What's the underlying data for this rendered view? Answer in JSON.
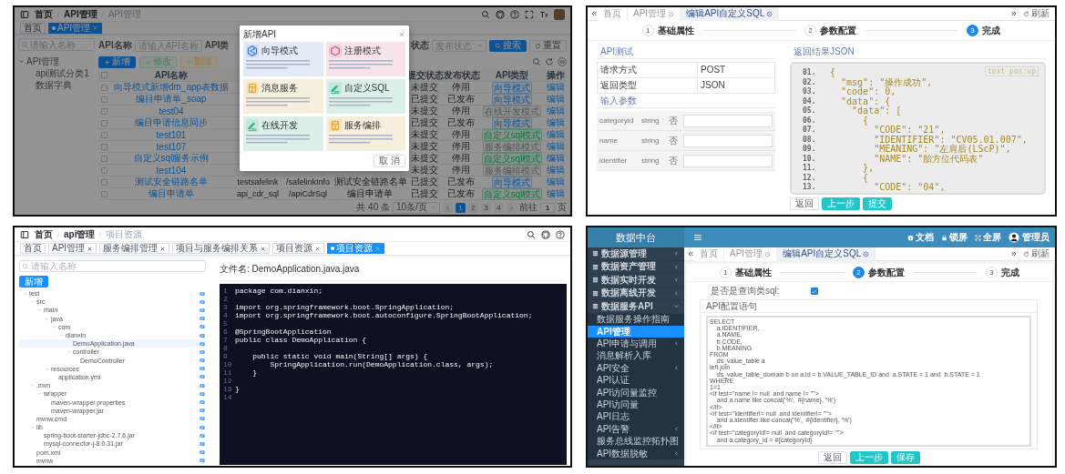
{
  "api_list_screen": {
    "breadcrumb": [
      "首页",
      "API管理",
      "API管理"
    ],
    "tags": [
      {
        "label": "首页",
        "selected": false,
        "closable": false
      },
      {
        "label": "API管理",
        "selected": true,
        "closable": true
      }
    ],
    "tree_search": {
      "placeholder": "请输入名称"
    },
    "tree": [
      {
        "label": "API管理",
        "expanded": true,
        "children": [
          {
            "label": "api测试分类1"
          },
          {
            "label": "数据字典"
          }
        ]
      }
    ],
    "filters": [
      {
        "label": "API名称",
        "kind": "input",
        "placeholder": "请输入API名称"
      },
      {
        "label": "API类",
        "kind": "label"
      },
      {
        "label": "状态",
        "kind": "select",
        "placeholder": "发布状态"
      }
    ],
    "filter_buttons": [
      {
        "label": "搜索",
        "kind": "primary"
      },
      {
        "label": "重置",
        "kind": "default"
      }
    ],
    "actions": [
      {
        "label": "新增",
        "kind": "add",
        "disabled": false
      },
      {
        "label": "修改",
        "kind": "edit",
        "disabled": true
      },
      {
        "label": "删除",
        "kind": "delete",
        "disabled": true
      }
    ],
    "columns": [
      "API名称",
      "提交状态",
      "发布状态",
      "API类型",
      "操作"
    ],
    "header_checked": false,
    "rows": [
      {
        "name": "向导模式新增dm_app表数据",
        "submit_status": "未提交",
        "publish_status": "停用",
        "api_type": {
          "label": "向导模式",
          "kind": "wizard"
        },
        "action": "编辑",
        "checked": false
      },
      {
        "name": "编目申请单_soap",
        "submit_status": "已提交",
        "publish_status": "已发布",
        "api_type": {
          "label": "向导模式",
          "kind": "wizard"
        },
        "action": "编辑",
        "checked": false
      },
      {
        "name": "test04",
        "submit_status": "未提交",
        "publish_status": "停用",
        "api_type": {
          "label": "在线开发模式",
          "kind": "plain"
        },
        "action": "编辑",
        "checked": false
      },
      {
        "name": "编目申请信息同步",
        "submit_status": "已提交",
        "publish_status": "已发布",
        "api_type": {
          "label": "向导模式",
          "kind": "wizard"
        },
        "action": "编辑",
        "checked": false
      },
      {
        "name": "test101",
        "submit_status": "未提交",
        "publish_status": "停用",
        "api_type": {
          "label": "自定义sql模式",
          "kind": "sql"
        },
        "action": "编辑",
        "checked": false
      },
      {
        "name": "test107",
        "submit_status": "未提交",
        "publish_status": "停用",
        "api_type": {
          "label": "服务编排模式",
          "kind": "plain"
        },
        "action": "编辑",
        "checked": false
      },
      {
        "name": "自定义sql服务示例",
        "submit_status": "未提交",
        "publish_status": "停用",
        "api_type": {
          "label": "自定义sql模式",
          "kind": "sql"
        },
        "action": "编辑",
        "checked": false
      },
      {
        "name": "test104",
        "submit_status": "未提交",
        "publish_status": "停用",
        "api_type": {
          "label": "服务编排模式",
          "kind": "plain"
        },
        "action": "编辑",
        "checked": false
      },
      {
        "name": "测试安全链路名单",
        "column_3": "testsafelink",
        "column_4": "/safelinkInfo",
        "column_5": "测试安全链路名单",
        "submit_status": "已提交",
        "publish_status": "已发布",
        "api_type": {
          "label": "向导模式",
          "kind": "wizard"
        },
        "action": "编辑",
        "checked": false
      },
      {
        "name": "编目申请单",
        "column_3": "api_cdr_sql",
        "column_4": "/apiCdrSql",
        "column_5": "编目申请单",
        "submit_status": "已提交",
        "publish_status": "已发布",
        "api_type": {
          "label": "自定义sql模式",
          "kind": "sql"
        },
        "action": "编辑",
        "checked": false
      }
    ],
    "pagination": {
      "total": "共 40 条",
      "page_size": "10条/页",
      "pages": [
        {
          "label": "1",
          "selected": true
        },
        {
          "label": "2",
          "selected": false
        },
        {
          "label": "3",
          "selected": false
        },
        {
          "label": "4",
          "selected": false
        }
      ],
      "goto_label": "前往",
      "goto_value": "1",
      "goto_suffix": "页"
    },
    "modal": {
      "title": "新增API",
      "cards": [
        {
          "title": "向导模式",
          "color": "#e3ebf6"
        },
        {
          "title": "注册模式",
          "color": "#f6e4ea"
        },
        {
          "title": "消息服务",
          "color": "#f6efde"
        },
        {
          "title": "自定义SQL",
          "color": "#dcefe9"
        },
        {
          "title": "在线开发",
          "color": "#dcefe9"
        },
        {
          "title": "服务编排",
          "color": "#f6efde"
        }
      ],
      "cancel": "取 消"
    }
  },
  "api_test_screen": {
    "tabs": [
      {
        "label": "首页",
        "selected": false,
        "closable": false
      },
      {
        "label": "API管理",
        "selected": false,
        "closable": true
      },
      {
        "label": "编辑API自定义SQL",
        "selected": true,
        "closable": true
      }
    ],
    "refresh": "刷新",
    "steps": [
      {
        "number": "1",
        "label": "基础属性",
        "selected": false
      },
      {
        "number": "2",
        "label": "参数配置",
        "selected": false
      },
      {
        "number": "3",
        "label": "完成",
        "selected": true
      }
    ],
    "test_title": "API测试",
    "info": [
      {
        "label": "请求方式",
        "value": "POST"
      },
      {
        "label": "返回类型",
        "value": "JSON"
      }
    ],
    "params_title": "输入参数",
    "params": [
      {
        "name": "categoryId",
        "type": "string",
        "required": "否"
      },
      {
        "name": "name",
        "type": "string",
        "required": "否"
      },
      {
        "name": "identifier",
        "type": "string",
        "required": "否"
      }
    ],
    "result_title": "返回结果JSON",
    "badge": "text pos:up",
    "lines": [
      {
        "number": "01.",
        "code": "{"
      },
      {
        "number": "02.",
        "code": "  \"msg\": \"操作成功\","
      },
      {
        "number": "03.",
        "code": "  \"code\": 0,"
      },
      {
        "number": "04.",
        "code": "  \"data\": {"
      },
      {
        "number": "05.",
        "code": "    \"data\": ["
      },
      {
        "number": "06.",
        "code": "      {"
      },
      {
        "number": "07.",
        "code": "        \"CODE\": \"21\","
      },
      {
        "number": "08.",
        "code": "        \"IDENTIFIER\": \"CV05.01.007\","
      },
      {
        "number": "09.",
        "code": "        \"MEANING\": \"左肩后(LScP)\","
      },
      {
        "number": "10.",
        "code": "        \"NAME\": \"胎方位代码表\""
      },
      {
        "number": "11.",
        "code": "      },"
      },
      {
        "number": "12.",
        "code": "      {"
      },
      {
        "number": "13.",
        "code": "        \"CODE\": \"04\","
      }
    ],
    "buttons": [
      {
        "label": "返回",
        "kind": "default"
      },
      {
        "label": "上一步",
        "kind": "primary"
      },
      {
        "label": "提交",
        "kind": "primary"
      }
    ]
  },
  "code_browser_screen": {
    "breadcrumb": [
      "首页",
      "api管理",
      "项目资源"
    ],
    "tags": [
      {
        "label": "首页",
        "selected": false,
        "closable": false
      },
      {
        "label": "API管理",
        "selected": false,
        "closable": true
      },
      {
        "label": "服务编排管理",
        "selected": false,
        "closable": true
      },
      {
        "label": "项目与服务编排关系",
        "selected": false,
        "closable": true
      },
      {
        "label": "项目资源",
        "selected": false,
        "closable": true
      },
      {
        "label": "项目资源",
        "selected": true,
        "closable": true
      }
    ],
    "search": {
      "placeholder": "请输入名称"
    },
    "add_button": "新增",
    "tree": [
      {
        "label": "test",
        "expanded": true,
        "selected": false,
        "children": [
          {
            "label": "src",
            "expanded": true,
            "selected": false,
            "children": [
              {
                "label": "main",
                "expanded": true,
                "selected": false,
                "children": [
                  {
                    "label": "java",
                    "expanded": true,
                    "selected": false,
                    "children": [
                      {
                        "label": "com",
                        "expanded": true,
                        "selected": false,
                        "children": [
                          {
                            "label": "dianxin",
                            "expanded": true,
                            "selected": false,
                            "children": [
                              {
                                "label": "DemoApplication.java",
                                "selected": true
                              },
                              {
                                "label": "controller",
                                "expanded": true,
                                "selected": false,
                                "children": [
                                  {
                                    "label": "DemoController",
                                    "selected": false
                                  }
                                ]
                              }
                            ]
                          }
                        ]
                      }
                    ]
                  },
                  {
                    "label": "resources",
                    "expanded": true,
                    "selected": false,
                    "children": [
                      {
                        "label": "application.yml",
                        "selected": false
                      }
                    ]
                  }
                ]
              }
            ]
          },
          {
            "label": ".mvn",
            "expanded": true,
            "selected": false,
            "children": [
              {
                "label": "wrapper",
                "expanded": true,
                "selected": false,
                "children": [
                  {
                    "label": "maven-wrapper.properties",
                    "selected": false
                  },
                  {
                    "label": "maven-wrapper.jar",
                    "selected": false
                  }
                ]
              }
            ]
          },
          {
            "label": "mvnw.cmd",
            "selected": false
          },
          {
            "label": "lib",
            "expanded": true,
            "selected": false,
            "children": [
              {
                "label": "spring-boot-starter-jdbc-2.7.6.jar",
                "selected": false
              },
              {
                "label": "mysql-connector-j-8.0.31.jar",
                "selected": false
              }
            ]
          },
          {
            "label": "pom.xml",
            "selected": false
          },
          {
            "label": "mvnw",
            "selected": false
          }
        ]
      }
    ],
    "file_title": "文件名: DemoApplication.java.java",
    "lines": [
      {
        "number": "1",
        "code": "package com.dianxin;"
      },
      {
        "number": "2"
      },
      {
        "number": "3",
        "code": "import org.springframework.boot.SpringApplication;"
      },
      {
        "number": "4",
        "code": "import org.springframework.boot.autoconfigure.SpringBootApplication;"
      },
      {
        "number": "5"
      },
      {
        "number": "6",
        "code": "@SpringBootApplication"
      },
      {
        "number": "7",
        "code": "public class DemoApplication {"
      },
      {
        "number": "8"
      },
      {
        "number": "9",
        "code": "    public static void main(String[] args) {"
      },
      {
        "number": "10",
        "code": "        SpringApplication.run(DemoApplication.class, args);"
      },
      {
        "number": "11",
        "code": "    }"
      },
      {
        "number": "12"
      },
      {
        "number": "13",
        "code": "}"
      },
      {
        "number": "14"
      }
    ]
  },
  "sql_config_screen": {
    "app_title": "数据中台",
    "menus": [
      {
        "label": "数据源管理",
        "expanded": false
      },
      {
        "label": "数据资产管理",
        "expanded": false
      },
      {
        "label": "数据实时开发",
        "expanded": false
      },
      {
        "label": "数据离线开发",
        "expanded": false
      },
      {
        "label": "数据服务API",
        "expanded": true,
        "children": [
          {
            "label": "数据服务操作指南",
            "selected": false,
            "submenu": false
          },
          {
            "label": "API管理",
            "selected": true,
            "submenu": false
          },
          {
            "label": "API申请与调用",
            "selected": false,
            "submenu": true
          },
          {
            "label": "消息解析入库",
            "selected": false,
            "submenu": false
          },
          {
            "label": "API安全",
            "selected": false,
            "submenu": true
          },
          {
            "label": "API认证",
            "selected": false,
            "submenu": false
          },
          {
            "label": "API访问量监控",
            "selected": false,
            "submenu": false
          },
          {
            "label": "API访问量",
            "selected": false,
            "submenu": false
          },
          {
            "label": "API日志",
            "selected": false,
            "submenu": false
          },
          {
            "label": "API告警",
            "selected": false,
            "submenu": true
          },
          {
            "label": "服务总线监控拓扑图",
            "selected": false,
            "submenu": false
          },
          {
            "label": "API数据脱敏",
            "selected": false,
            "submenu": true
          }
        ]
      }
    ],
    "header_links": [
      {
        "label": "文档"
      },
      {
        "label": "锁屏"
      },
      {
        "label": "全屏"
      }
    ],
    "user": "管理员",
    "tabs": [
      {
        "label": "首页",
        "selected": false,
        "closable": false
      },
      {
        "label": "API管理",
        "selected": false,
        "closable": true
      },
      {
        "label": "编辑API自定义SQL",
        "selected": true,
        "closable": true
      }
    ],
    "refresh": "刷新",
    "steps": [
      {
        "number": "1",
        "label": "基础属性",
        "selected": false
      },
      {
        "number": "2",
        "label": "参数配置",
        "selected": true
      },
      {
        "number": "3",
        "label": "完成",
        "selected": false
      }
    ],
    "query_checkbox": {
      "label": "是否是查询类sql:",
      "checked": true
    },
    "config_title": "API配置语句",
    "sql": "SELECT\n\ta.IDENTIFIER,\n\ta.NAME,\n\tb.CODE,\n\tb.MEANING\nFROM\n\tds_value_table a\nleft join\n\tds_value_table_domain b on a.id = b.VALUE_TABLE_ID and  a.STATE = 1 and  b.STATE = 1\nWHERE\n1=1\n<if test=\"name != null  and name != ''\">\n\tand a.name like concat('%',  #{name}, '%')\n</if>\n<if test=\"identifier!= null  and identifier!= ''\">\n\tand a.identifier like concat('%',  #{identifier}, '%')\n</if>\n<if test=\"categoryId!= null  and categoryId!= ''\">\n\tand a.category_id = #{categoryId}",
    "buttons": [
      {
        "label": "返回",
        "kind": "default"
      },
      {
        "label": "上一步",
        "kind": "primary"
      },
      {
        "label": "保存",
        "kind": "primary"
      }
    ]
  }
}
